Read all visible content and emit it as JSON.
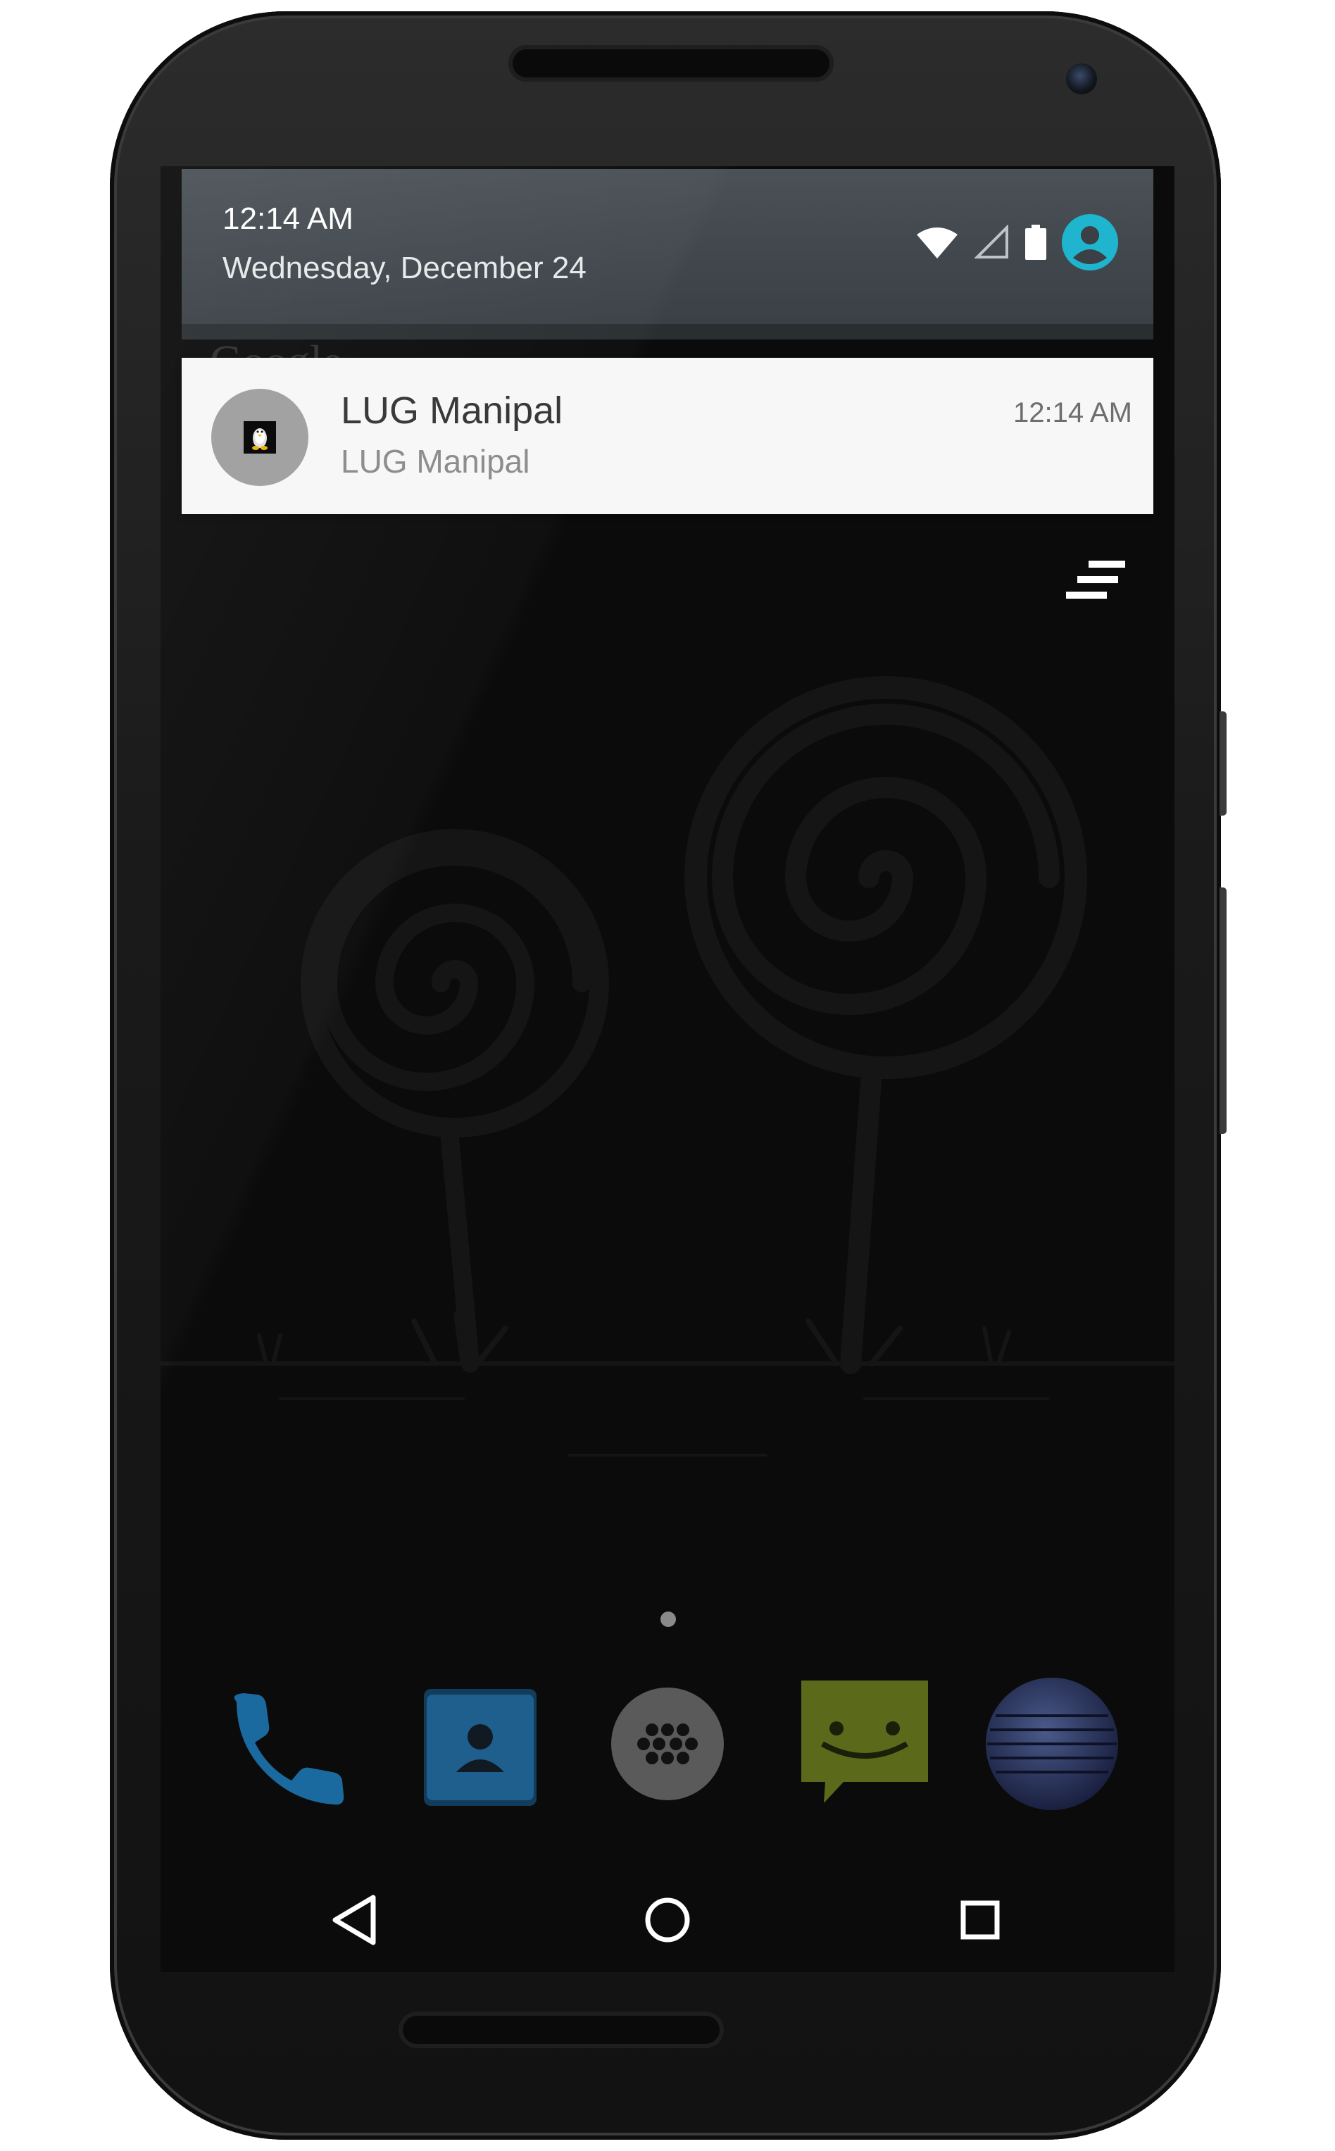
{
  "status_bar": {
    "time": "12:14 AM",
    "date": "Wednesday, December 24",
    "icons": [
      "wifi-icon",
      "cell-signal-icon",
      "battery-icon",
      "user-account-icon"
    ],
    "accent_color": "#1fb5cf"
  },
  "background": {
    "behind_text": "Google"
  },
  "notification": {
    "app_icon": "lug-manipal-tux-icon",
    "title": "LUG Manipal",
    "text": "LUG Manipal",
    "time": "12:14 AM"
  },
  "actions": {
    "dismiss_all_icon": "clear-all-icon"
  },
  "dock": {
    "items": [
      {
        "name": "phone-app-icon",
        "color": "#1a6aa0"
      },
      {
        "name": "contacts-app-icon",
        "color": "#1e5f8e"
      },
      {
        "name": "app-drawer-icon",
        "color": "#5a5a5a"
      },
      {
        "name": "messaging-app-icon",
        "color": "#5a6a1a"
      },
      {
        "name": "browser-globe-icon",
        "color": "#3a4a7a"
      }
    ]
  },
  "nav": {
    "buttons": [
      "back-icon",
      "home-icon",
      "recents-icon"
    ]
  }
}
